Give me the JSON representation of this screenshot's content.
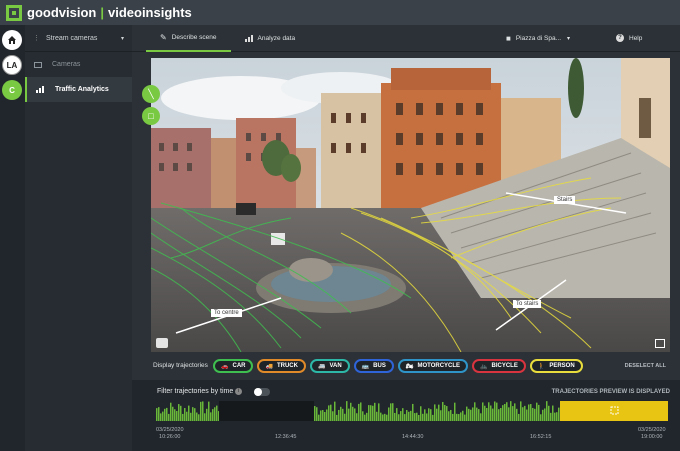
{
  "app": {
    "brand_left": "goodvision",
    "brand_sep": "|",
    "brand_right": "videoinsights"
  },
  "rail": {
    "home_icon": "home-icon",
    "items": [
      "LA",
      "C"
    ]
  },
  "sidebar": {
    "header": "Stream cameras",
    "items": [
      {
        "label": "Cameras",
        "icon": "camera-icon"
      },
      {
        "label": "Traffic Analytics",
        "icon": "chart-icon"
      }
    ]
  },
  "tabs": [
    {
      "label": "Describe scene",
      "icon": "pencil-icon"
    },
    {
      "label": "Analyze data",
      "icon": "chart-icon"
    }
  ],
  "camera_select": {
    "value": "Piazza di Spa..."
  },
  "help": {
    "label": "Help"
  },
  "scene": {
    "lines": [
      {
        "label": "Stairs"
      },
      {
        "label": "To stairs"
      },
      {
        "label": "To centre"
      }
    ]
  },
  "filters": {
    "title": "Display trajectories",
    "chips": [
      {
        "label": "CAR",
        "color": "#3fbf4f"
      },
      {
        "label": "TRUCK",
        "color": "#e08a2a"
      },
      {
        "label": "VAN",
        "color": "#2cb7a6"
      },
      {
        "label": "BUS",
        "color": "#2f63d8"
      },
      {
        "label": "MOTORCYCLE",
        "color": "#2f95c8"
      },
      {
        "label": "BICYCLE",
        "color": "#d8343f"
      },
      {
        "label": "PERSON",
        "color": "#e8dd3c"
      }
    ],
    "deselect": "DESELECT ALL"
  },
  "timeline": {
    "filter_label": "Filter trajectories by time",
    "preview_text": "TRAJECTORIES PREVIEW IS DISPLAYED",
    "ticks": [
      {
        "date": "03/25/2020",
        "time": "10:26:00"
      },
      {
        "date": "",
        "time": "12:36:45"
      },
      {
        "date": "",
        "time": "14:44:30"
      },
      {
        "date": "",
        "time": "16:52:15"
      },
      {
        "date": "03/25/2020",
        "time": "19:00:00"
      }
    ]
  }
}
